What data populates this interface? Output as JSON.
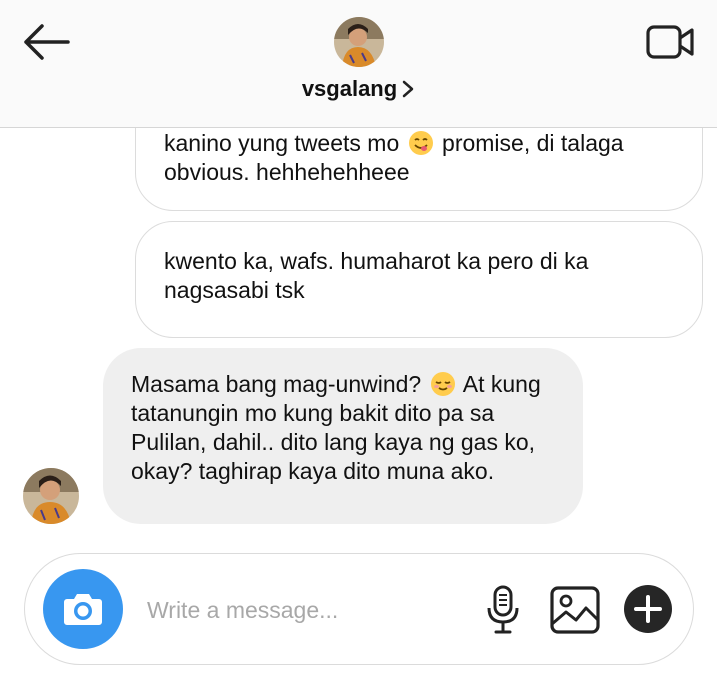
{
  "header": {
    "username": "vsgalang",
    "icons": {
      "back": "back-arrow-icon",
      "video": "video-call-icon",
      "chevron": "chevron-right-icon"
    }
  },
  "messages": [
    {
      "direction": "sent",
      "line1": "kanino yung tweets mo",
      "emoji": "yum-face-emoji",
      "line1b": "promise, di talaga",
      "line2": "obvious. hehhehehheee"
    },
    {
      "direction": "sent",
      "line1": "kwento ka, wafs. humaharot ka pero di ka",
      "line2": "nagsasabi tsk"
    },
    {
      "direction": "received",
      "line1": "Masama bang mag-unwind?",
      "emoji": "relieved-face-emoji",
      "line1b": "At kung",
      "line2": "tatanungin mo kung bakit dito pa sa",
      "line3": "Pulilan, dahil.. dito lang kaya ng gas ko,",
      "line4": "okay? taghirap kaya dito muna ako."
    }
  ],
  "composer": {
    "placeholder": "Write a message...",
    "icons": {
      "camera": "camera-icon",
      "mic": "microphone-icon",
      "gallery": "image-gallery-icon",
      "plus": "plus-icon"
    }
  },
  "colors": {
    "accent": "#3897f0",
    "received_bubble": "#efefef",
    "header_bg": "#fafafa"
  }
}
